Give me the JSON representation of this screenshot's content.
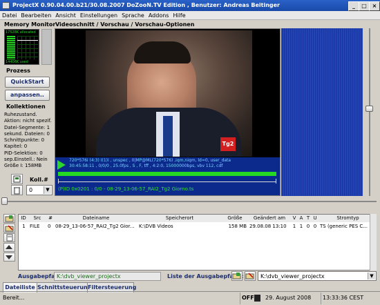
{
  "window": {
    "title": "ProjectX 0.90.04.00.b21/30.08.2007 DoZooN.TV Edition , Benutzer: Andreas Beitinger",
    "minimize": "_",
    "maximize": "□",
    "close": "×"
  },
  "menu": [
    "Datei",
    "Bearbeiten",
    "Ansicht",
    "Einstellungen",
    "Sprache",
    "Addons",
    "Hilfe"
  ],
  "memory": {
    "title": "Memory Monitor",
    "allocated": "17528K allocated",
    "used": "14406K used"
  },
  "process": {
    "title": "Prozess",
    "quickstart": "QuickStart",
    "adjust": "anpassen.."
  },
  "collections": {
    "title": "Kollektionen",
    "info": [
      "Ruhezustand.",
      "Aktion: nicht spezif.",
      "Datei-Segmente: 1",
      "sekund. Dateien: 0",
      "Schnittpunkte: 0",
      "Kapitel: 0",
      "PID-Selektion: 0",
      "sep.Einstell.: Nein",
      "Größe I: 158MB"
    ],
    "koll_label": "Koll.#",
    "koll_value": "0"
  },
  "video": {
    "title": "Videoschnitt / Vorschau / Vorschau-Optionen",
    "logo": "Tg2",
    "info_line1": "720*576i (4:3) I(1)i , unspec , 0|MP@ML(720*576) ,iqm,niqm, ld=0, user_data",
    "info_line2": "30:45:58:11 , 0/0/0 , 25.0fps , S , F, tff , 4:2:0, 15000000bps, vbv 112, cdf",
    "file_line": "(P)ID 0x0201 : 0/0 - 08-29_13-06-57_RAI2_Tg2 Giorno.ts"
  },
  "table": {
    "headers": [
      "ID",
      "Src",
      "#",
      "Dateiname",
      "Speicherort",
      "Größe",
      "Geändert am",
      "V",
      "A",
      "T",
      "U",
      "Stromtyp"
    ],
    "rows": [
      [
        "1",
        "FILE",
        "0",
        "08-29_13-06-57_RAI2_Tg2 Gior...",
        "K:\\DVB Videos",
        "158 MB",
        "29.08.08  13:10",
        "1",
        "1",
        "0",
        "0",
        "TS (generic PES C..."
      ]
    ]
  },
  "output": {
    "path_label": "Ausgabepfad:",
    "path_value": "K:\\dvb_viewer_projectx",
    "list_label": "Liste der Ausgabepfade:",
    "list_value": "K:\\dvb_viewer_projectx"
  },
  "tabs": [
    "Dateiliste",
    "Schnittsteuerung",
    "Filtersteuerung"
  ],
  "statusbar": {
    "ready": "Bereit...",
    "off": "OFF",
    "date": "29. August 2008",
    "time": "13:33:36 CEST"
  },
  "colors": {
    "titlebar": "#1a4aa8",
    "video_bg": "#0a1a6a",
    "info_bg": "#0b2a8c",
    "info_text": "#7ad6ff",
    "file_text": "#35e035",
    "mem_green": "#24d824"
  }
}
